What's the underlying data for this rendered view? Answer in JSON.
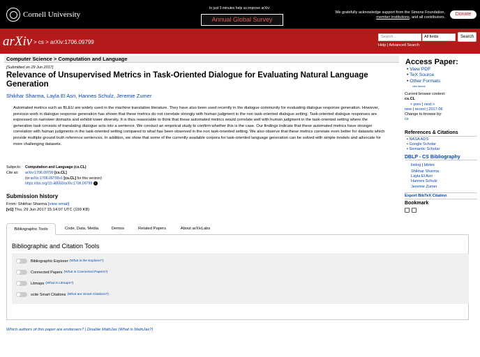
{
  "banner": {
    "institution": "Cornell University",
    "survey_msg": "In just 3 minutes help us improve arXiv:",
    "survey_label": "Annual Global Survey",
    "support_prefix": "We gratefully acknowledge support from the Simons Foundation,",
    "support_link": "member institutions",
    "support_suffix": ", and all contributors.",
    "donate": "Donate"
  },
  "header": {
    "logo": "arXiv",
    "breadcrumb": "> cs > arXiv:1706.09799",
    "search_placeholder": "Search...",
    "search_field": "All fields",
    "search_button": "Search",
    "help": "Help",
    "separator": "|",
    "advanced": "Advanced Search"
  },
  "paper": {
    "heading": "Computer Science > Computation and Language",
    "submitted": "[Submitted on 29 Jun 2017]",
    "title": "Relevance of Unsupervised Metrics in Task-Oriented Dialogue for Evaluating Natural Language Generation",
    "authors": [
      "Shikhar Sharma",
      "Layla El Asri",
      "Hannes Schulz",
      "Jeremie Zumer"
    ],
    "abstract": "Automated metrics such as BLEU are widely used in the machine translation literature. They have also been used recently in the dialogue community for evaluating dialogue response generation. However, previous work in dialogue response generation has shown that these metrics do not correlate strongly with human judgment in the non task-oriented dialogue setting. Task-oriented dialogue responses are expressed on narrower domains and exhibit lower diversity. It is thus reasonable to think that these automated metrics would correlate well with human judgment in the task-oriented setting where the generation task consists of translating dialogue acts into a sentence. We conduct an empirical study to confirm whether this is the case. Our findings indicate that these automated metrics have stronger correlation with human judgments in the task-oriented setting compared to what has been observed in the non task-oriented setting. We also observe that these metrics correlate even better for datasets which provide multiple ground truth reference sentences. In addition, we show that some of the currently available corpora for task-oriented language generation can be solved with simple models and advocate for more challenging datasets.",
    "subjects_label": "Subjects:",
    "subjects": "Computation and Language (cs.CL)",
    "cite_label": "Cite as:",
    "cite_id": "arXiv:1706.09799",
    "cite_tag": "[cs.CL]",
    "cite_or_prefix": "(or",
    "cite_version": "arXiv:1706.09799v1",
    "cite_version_tag": "[cs.CL]",
    "cite_or_suffix": "for this version)",
    "doi": "https://doi.org/10.48550/arXiv.1706.09799",
    "info_glyph": "i"
  },
  "history": {
    "title": "Submission history",
    "from_prefix": "From: Shikhar Sharma",
    "view_email": "[view email]",
    "version_label": "[v1]",
    "version_text": "Thu, 29 Jun 2017 15:14:07 UTC (199 KB)"
  },
  "tabs": [
    {
      "label": "Bibliographic Tools"
    },
    {
      "label": "Code, Data, Media"
    },
    {
      "label": "Demos"
    },
    {
      "label": "Related Papers"
    },
    {
      "label": "About arXivLabs"
    }
  ],
  "tools": {
    "title": "Bibliographic and Citation Tools",
    "items": [
      {
        "label": "Bibliographic Explorer",
        "what": "(What is the Explorer?)"
      },
      {
        "label": "Connected Papers",
        "what": "(What is Connected Papers?)"
      },
      {
        "label": "Litmaps",
        "what": "(What is Litmaps?)"
      },
      {
        "label": "scite Smart Citations",
        "what": "(What are Smart Citations?)"
      }
    ]
  },
  "footer_links": {
    "endorsers": "Which authors of this paper are endorsers?",
    "sep": "|",
    "mathjax": "Disable MathJax",
    "what_mathjax": "(What is MathJax?)"
  },
  "sidebar": {
    "access_title": "Access Paper:",
    "access": [
      "View PDF",
      "TeX Source",
      "Other Formats"
    ],
    "license": "view license",
    "context_label": "Current browse context:",
    "context": "cs.CL",
    "prev": "< prev",
    "sep": "|",
    "next": "next >",
    "new": "new",
    "recent": "recent",
    "date": "2017-06",
    "change_label": "Change to browse by:",
    "change": "cs",
    "refs_title": "References & Citations",
    "refs": [
      "NASA ADS",
      "Google Scholar",
      "Semantic Scholar"
    ],
    "dblp_title": "DBLP",
    "dblp_suffix": " - CS Bibliography",
    "dblp_listing": "listing",
    "dblp_bibtex": "bibtex",
    "dblp_authors": [
      "Shikhar Sharma",
      "Layla El Asri",
      "Hannes Schulz",
      "Jeremie Zumer"
    ],
    "export": "Export BibTeX Citation",
    "bookmark": "Bookmark"
  }
}
